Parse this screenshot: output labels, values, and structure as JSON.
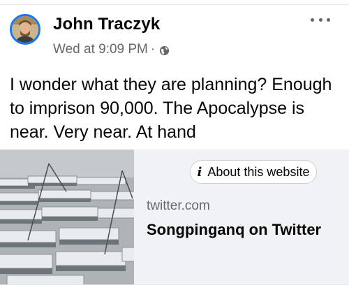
{
  "post": {
    "author": "John Traczyk",
    "timestamp": "Wed at 9:09 PM",
    "separator": "·",
    "audience_icon": "globe-icon",
    "text": "I wonder what they are planning? Enough to imprison 90,000. The Apocalypse is near. Very near. At hand",
    "more_icon": "more-options-icon"
  },
  "link_preview": {
    "about_icon": "info-icon",
    "about_glyph": "i",
    "about_label": "About this website",
    "domain": "twitter.com",
    "title": "Songpinganq on Twitter"
  },
  "colors": {
    "accent": "#1877f2",
    "secondary_text": "#65676b",
    "card_background": "#f0f2f5"
  }
}
